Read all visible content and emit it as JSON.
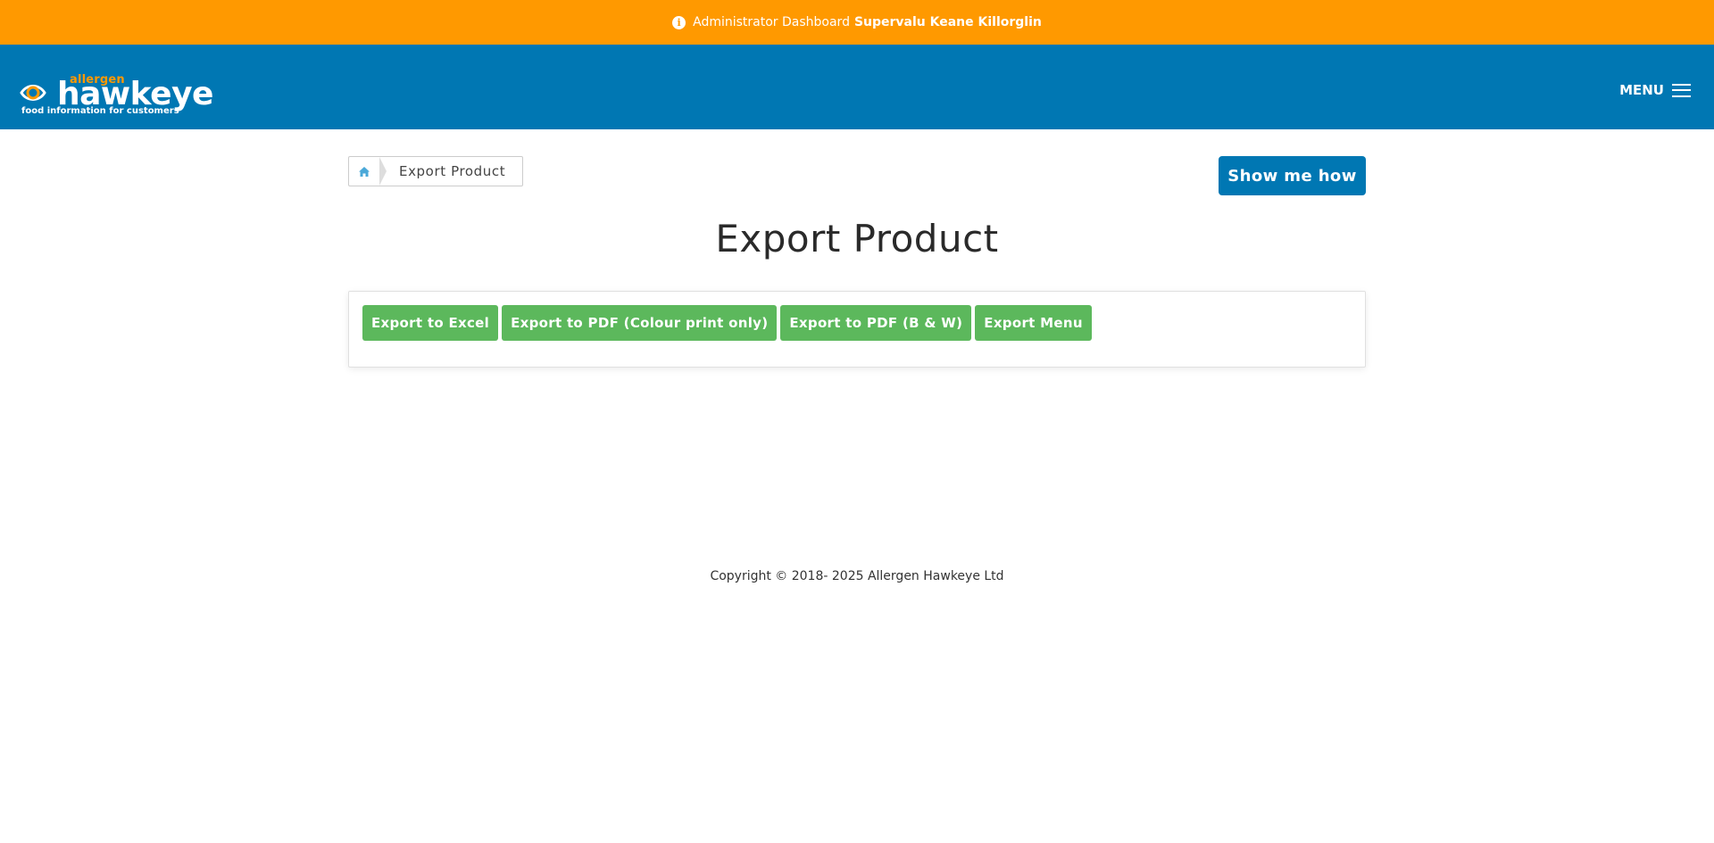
{
  "notice": {
    "icon": "info-icon",
    "text": "Administrator Dashboard",
    "store_name": "Supervalu Keane Killorglin"
  },
  "header": {
    "logo": {
      "allergen": "allergen",
      "brand": "hawkeye",
      "tagline": "food information for customers"
    },
    "menu_label": "MENU"
  },
  "breadcrumb": {
    "home_icon": "home-icon",
    "current": "Export Product"
  },
  "help_button": "Show me how",
  "page_title": "Export Product",
  "export_buttons": [
    "Export to Excel",
    "Export to PDF (Colour print only)",
    "Export to PDF (B & W)",
    "Export Menu"
  ],
  "footer": {
    "copyright": "Copyright © 2018- 2025 Allergen Hawkeye Ltd"
  },
  "colors": {
    "notice_bg": "#ff9900",
    "header_bg": "#0077b3",
    "button_primary": "#0077b3",
    "button_success": "#5cb85c"
  }
}
